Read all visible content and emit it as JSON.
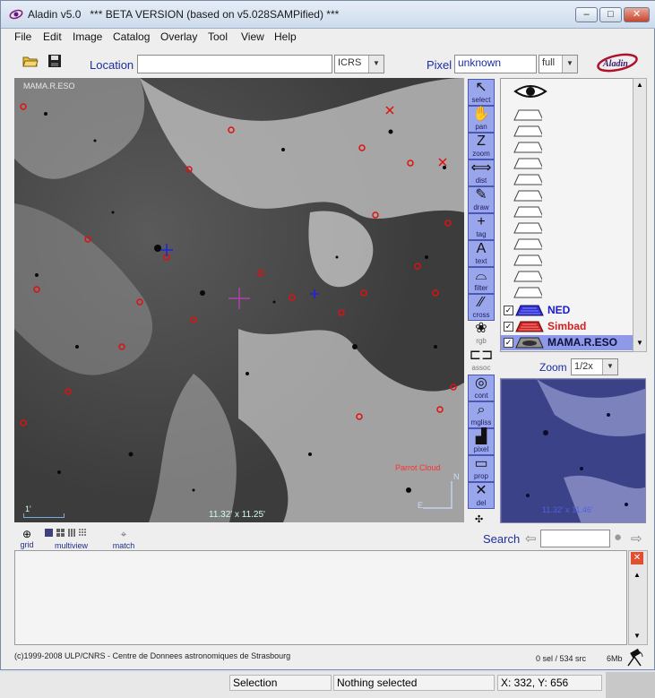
{
  "window": {
    "app_title": "Aladin v5.0",
    "subtitle": "*** BETA VERSION (based on v5.028SAMPified) ***",
    "minimize": "–",
    "maximize": "□",
    "close": "✕"
  },
  "menu": [
    "File",
    "Edit",
    "Image",
    "Catalog",
    "Overlay",
    "Tool",
    "View",
    "Help"
  ],
  "toolbar": {
    "location_label": "Location",
    "location_value": "",
    "frame_value": "ICRS",
    "pixel_label": "Pixel",
    "pixel_value": "unknown",
    "pixel_mode": "full",
    "logo_text": "Aladin"
  },
  "skyview": {
    "survey_label": "MAMA.R.ESO",
    "scale_label": "1'",
    "fov_label": "11.32' x 11.25'",
    "annotation": "Parrot Cloud",
    "north": "N",
    "east": "E"
  },
  "tools": [
    {
      "label": "select",
      "glyph": "↖",
      "active": true
    },
    {
      "label": "pan",
      "glyph": "✋",
      "active": true
    },
    {
      "label": "zoom",
      "glyph": "Z",
      "active": true
    },
    {
      "label": "dist",
      "glyph": "⟺",
      "active": true
    },
    {
      "label": "draw",
      "glyph": "✎",
      "active": true
    },
    {
      "label": "tag",
      "glyph": "+",
      "active": true
    },
    {
      "label": "text",
      "glyph": "A",
      "active": true
    },
    {
      "label": "filter",
      "glyph": "⌓",
      "active": true
    },
    {
      "label": "cross",
      "glyph": "⁄⁄",
      "active": true
    },
    {
      "label": "rgb",
      "glyph": "❀",
      "active": false
    },
    {
      "label": "assoc",
      "glyph": "⊏⊐",
      "active": false
    },
    {
      "label": "cont",
      "glyph": "◎",
      "active": true
    },
    {
      "label": "mgliss",
      "glyph": "⌕",
      "active": true
    },
    {
      "label": "pixel",
      "glyph": "▟",
      "active": true
    },
    {
      "label": "prop",
      "glyph": "▭",
      "active": true
    },
    {
      "label": "del",
      "glyph": "✕",
      "active": true
    }
  ],
  "layers": [
    {
      "name": "NED",
      "color": "#1a1ad0",
      "checked": true
    },
    {
      "name": "Simbad",
      "color": "#d02020",
      "checked": true
    },
    {
      "name": "MAMA.R.ESO",
      "color": "#101060",
      "checked": true
    }
  ],
  "zoom": {
    "label": "Zoom",
    "value": "1/2x",
    "fov_small": "11.32' x 11.46'"
  },
  "bottombar": {
    "grid": "grid",
    "multiview": "multiview",
    "match": "match",
    "search_label": "Search",
    "search_value": ""
  },
  "footer": {
    "copyright": "(c)1999-2008 ULP/CNRS - Centre de Donnees astronomiques de Strasbourg",
    "sel": "0 sel / 534 src",
    "mem": "6Mb"
  },
  "status": {
    "left": "Selection",
    "middle": "Nothing selected",
    "coords": "X: 332, Y: 656"
  },
  "colors": {
    "tool_bg": "#9aa6ec",
    "simbad": "#d02020",
    "ned": "#1a1ad0",
    "selected_layer": "#8e9ae8"
  }
}
